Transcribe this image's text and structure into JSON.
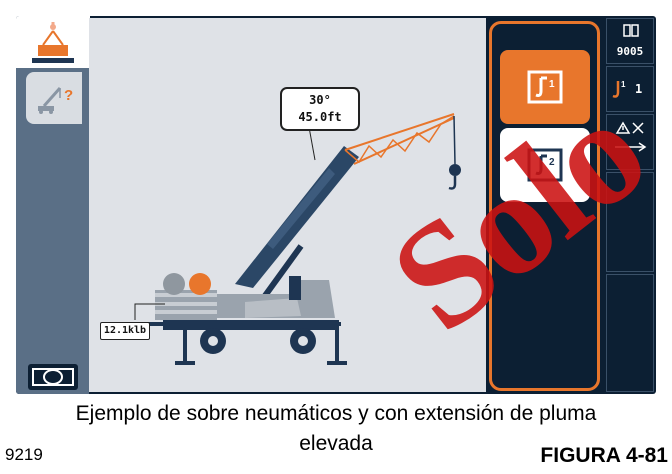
{
  "readout": {
    "angle": "30°",
    "length": "45.0ft"
  },
  "load": {
    "weight": "12.1klb"
  },
  "hooks": [
    {
      "label": "1",
      "selected": true
    },
    {
      "label": "2",
      "selected": false
    }
  ],
  "right_bar": {
    "counter": "9005",
    "hook_status": "1"
  },
  "caption": {
    "line1": "Ejemplo de sobre neumáticos y con extensión de pluma",
    "line2": "elevada"
  },
  "figure": {
    "id": "9219",
    "number": "FIGURA 4-81"
  },
  "watermark": "Solo",
  "colors": {
    "accent": "#e8762c",
    "background": "#0c1f33",
    "panel": "#dfe2e7",
    "crane": "#1e3552",
    "watermark": "#cc1212"
  },
  "icons": [
    "lift-hook-icon",
    "crane-help-icon",
    "camera-view-icon",
    "counter-icon",
    "hook-1-icon",
    "hook-2-icon",
    "cross-slope-icon"
  ]
}
